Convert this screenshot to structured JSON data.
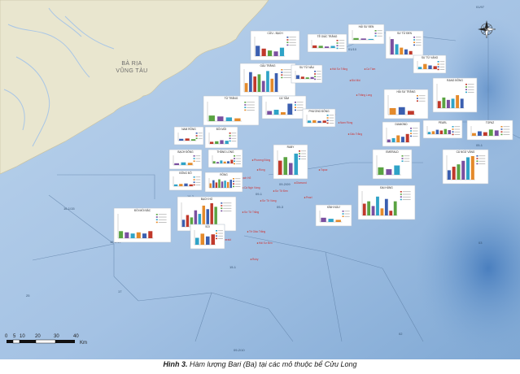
{
  "caption": {
    "figure": "Hình 3.",
    "text": "Hàm lượng Bari (Ba) tại các mỏ thuộc bể Cửu Long"
  },
  "map": {
    "town_lines": [
      "BÀ RỊA",
      "VŨNG TÀU"
    ],
    "compass": "compass-rose",
    "scale": {
      "ticks": [
        "0",
        "5",
        "10",
        "20",
        "30",
        "40"
      ],
      "unit": "Km"
    },
    "blocks": [
      "01/97",
      "01/10",
      "16-1/15",
      "16-2",
      "09-2/09",
      "09-1",
      "09-3",
      "25",
      "17",
      "15-2/10",
      "09-2/10",
      "02",
      "03",
      "05-1",
      "15-1"
    ],
    "fields": [
      "Bạch Hổ",
      "Rồng",
      "Cá Ngừ Vàng",
      "Rạng Đông",
      "Phương Đông",
      "Sư Tử Đen",
      "Sư Tử Vàng",
      "Sư Tử Trắng",
      "Tê Giác Trắng",
      "Hải Sư Đen",
      "Hải Sư Trắng",
      "Đồi Mồi",
      "Thăng Long",
      "Đông Đô",
      "Nam Rồng",
      "Gấu Trắng",
      "Cá Tầm",
      "Diamond",
      "Pearl",
      "Topaz",
      "Ruby",
      "Emerald"
    ]
  },
  "panels": [
    {
      "title": "CỬU - BẠCH",
      "values": [
        0.55,
        0.4,
        0.3,
        0.25,
        0.45
      ]
    },
    {
      "title": "TÊ GIÁC TRẮNG",
      "values": [
        0.35,
        0.3,
        0.2,
        0.28
      ]
    },
    {
      "title": "HẢI SƯ ĐEN",
      "values": [
        0.2,
        0.15,
        0.1
      ]
    },
    {
      "title": "SƯ TỬ ĐEN",
      "values": [
        0.9,
        0.6,
        0.4,
        0.3,
        0.2
      ]
    },
    {
      "title": "SƯ TỬ VÀNG",
      "values": [
        0.3,
        0.7,
        0.5,
        0.4
      ]
    },
    {
      "title": "GẤU TRẮNG",
      "values": [
        0.4,
        0.9,
        0.7,
        0.8,
        0.5,
        0.95,
        0.6,
        0.85
      ]
    },
    {
      "title": "SƯ TỬ NÂU",
      "values": [
        0.5,
        0.3,
        0.2,
        0.25
      ]
    },
    {
      "title": "RẠNG ĐÔNG",
      "values": [
        0.3,
        0.45,
        0.35,
        0.4,
        0.55,
        0.4
      ]
    },
    {
      "title": "TỬ TRẮNG",
      "values": [
        0.3,
        0.25,
        0.2,
        0.15
      ]
    },
    {
      "title": "CÁ TẦM",
      "values": [
        0.3,
        0.4,
        0.2,
        0.9
      ]
    },
    {
      "title": "PHƯƠNG ĐÔNG",
      "values": [
        0.3,
        0.35,
        0.25,
        0.3
      ]
    },
    {
      "title": "HẢI SƯ TRẮNG",
      "values": [
        0.35,
        0.4,
        0.2
      ]
    },
    {
      "title": "NAM RỒNG",
      "values": [
        0.25,
        0.3,
        0.2
      ]
    },
    {
      "title": "ĐỒI MỒI",
      "values": [
        0.2,
        0.25,
        0.35,
        0.3
      ]
    },
    {
      "title": "THĂNG LONG",
      "values": [
        0.3,
        0.2,
        0.4,
        0.25,
        0.3,
        0.5
      ]
    },
    {
      "title": "BẠCH ĐÔNG",
      "values": [
        0.2,
        0.3,
        0.25
      ]
    },
    {
      "title": "ĐÔNG ĐÔ",
      "values": [
        0.2,
        0.25,
        0.3,
        0.2
      ]
    },
    {
      "title": "RỒNG",
      "values": [
        0.5,
        0.85,
        0.6,
        0.95,
        0.7,
        0.8,
        0.65,
        0.9
      ]
    },
    {
      "title": "BẠCH HỔ",
      "values": [
        0.3,
        0.5,
        0.4,
        0.7,
        0.55,
        0.9,
        0.75,
        1.0,
        0.85
      ]
    },
    {
      "title": "RUBY",
      "values": [
        0.6,
        0.75,
        0.5,
        0.9
      ]
    },
    {
      "title": "EMERALD",
      "values": [
        0.4,
        0.3,
        0.5
      ]
    },
    {
      "title": "DIAMOND",
      "values": [
        0.2,
        0.3,
        0.5,
        0.4,
        0.6
      ]
    },
    {
      "title": "PEARL",
      "values": [
        0.3,
        0.4,
        0.6,
        0.5,
        0.7,
        0.55
      ]
    },
    {
      "title": "TOPAZ",
      "values": [
        0.3,
        0.5,
        0.4,
        0.7,
        0.6
      ]
    },
    {
      "title": "CÁ NGỪ VÀNG",
      "values": [
        0.4,
        0.55,
        0.65,
        0.8,
        0.95,
        1.0
      ]
    },
    {
      "title": "ĐẠI HÙNG",
      "values": [
        0.5,
        0.6,
        0.4,
        0.8,
        0.3,
        0.7,
        0.2,
        0.6
      ]
    },
    {
      "title": "ĐỒI MỒI BẮC",
      "values": [
        0.3,
        0.25,
        0.2,
        0.25,
        0.2,
        0.3
      ]
    },
    {
      "title": "KÌNH NGƯ",
      "values": [
        0.4,
        0.3,
        0.2
      ]
    },
    {
      "title": "SÓI",
      "values": [
        0.5,
        0.8,
        0.6,
        0.75
      ]
    }
  ],
  "colors": {
    "land": "#e9e6cf",
    "sea": "#a9c6e6",
    "deep": "#5f90c6",
    "bar_series": [
      "#3b5fb0",
      "#c0392b",
      "#5aa342",
      "#7a4fa0",
      "#2fa3c7",
      "#e48a2b"
    ]
  }
}
